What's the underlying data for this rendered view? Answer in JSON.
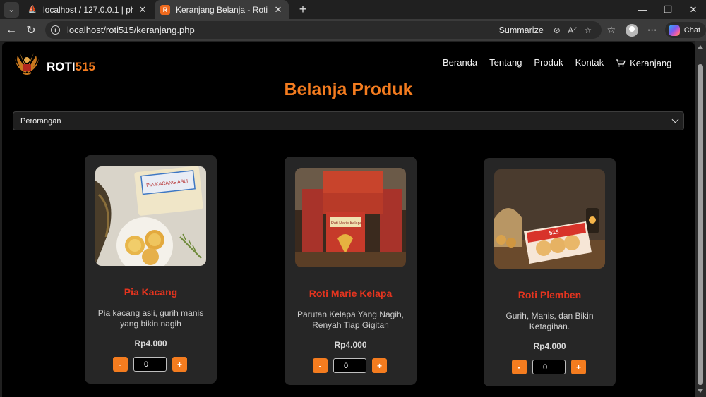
{
  "browser": {
    "tabs": [
      {
        "title": "localhost / 127.0.0.1 | phpMyAdmi",
        "close": "✕"
      },
      {
        "title": "Keranjang Belanja - Roti 515",
        "close": "✕"
      }
    ],
    "url": "localhost/roti515/keranjang.php",
    "summarize": "Summarize",
    "chat": "Chat"
  },
  "site": {
    "brand_main": "ROTI",
    "brand_accent": "515",
    "nav": [
      "Beranda",
      "Tentang",
      "Produk",
      "Kontak"
    ],
    "cart": "Keranjang",
    "heading": "Belanja Produk",
    "select_value": "Perorangan"
  },
  "products": [
    {
      "name": "Pia Kacang",
      "desc": "Pia kacang asli, gurih manis yang bikin nagih",
      "price": "Rp4.000",
      "qty": "0",
      "minus": "-",
      "plus": "+",
      "photo_label": "PIA KACANG ASLI"
    },
    {
      "name": "Roti Marie Kelapa",
      "desc": "Parutan Kelapa Yang Nagih, Renyah Tiap Gigitan",
      "price": "Rp4.000",
      "qty": "0",
      "minus": "-",
      "plus": "+",
      "photo_label": "Roti Marie Kelapa"
    },
    {
      "name": "Roti Plemben",
      "desc": "Gurih, Manis, dan Bikin Ketagihan.",
      "price": "Rp4.000",
      "qty": "0",
      "minus": "-",
      "plus": "+",
      "photo_label": "515"
    }
  ],
  "colors": {
    "accent": "#f47c1f",
    "product_name": "#e3341f",
    "card_bg": "#262626"
  }
}
